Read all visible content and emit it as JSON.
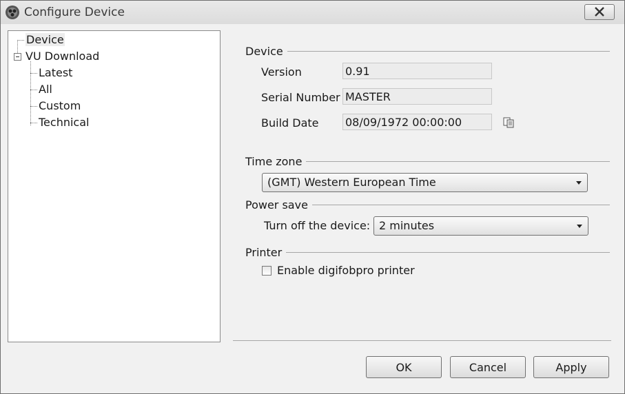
{
  "window": {
    "title": "Configure Device"
  },
  "tree": {
    "device": "Device",
    "vu_download": "VU Download",
    "children": [
      "Latest",
      "All",
      "Custom",
      "Technical"
    ]
  },
  "device_group": {
    "title": "Device",
    "version_label": "Version",
    "version_value": "0.91",
    "serial_label": "Serial Number",
    "serial_value": "MASTER",
    "build_label": "Build Date",
    "build_value": "08/09/1972 00:00:00"
  },
  "timezone_group": {
    "title": "Time zone",
    "selected": "(GMT) Western European Time"
  },
  "power_group": {
    "title": "Power save",
    "label": "Turn off the device:",
    "selected": "2 minutes"
  },
  "printer_group": {
    "title": "Printer",
    "checkbox_label": "Enable digifobpro printer",
    "checked": false
  },
  "buttons": {
    "ok": "OK",
    "cancel": "Cancel",
    "apply": "Apply"
  }
}
